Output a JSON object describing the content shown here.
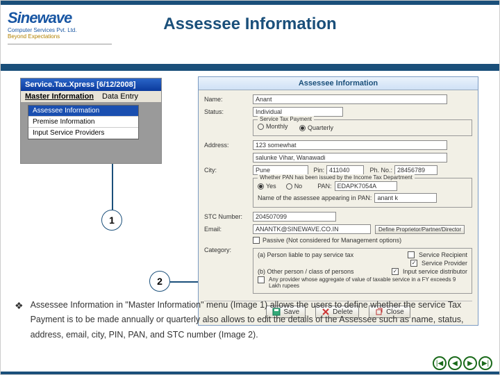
{
  "logo": {
    "name": "Sinewave",
    "sub1": "Computer Services Pvt. Ltd.",
    "sub2": "Beyond Expectations"
  },
  "page_title": "Assessee Information",
  "menu": {
    "window_title": "Service.Tax.Xpress  [6/12/2008]",
    "bar": [
      "Master Information",
      "Data Entry"
    ],
    "items": [
      "Assessee Information",
      "Premise Information",
      "Input Service Providers"
    ]
  },
  "callouts": {
    "one": "1",
    "two": "2"
  },
  "dialog": {
    "title": "Assessee Information",
    "labels": {
      "name": "Name:",
      "status": "Status:",
      "address": "Address:",
      "city": "City:",
      "pin": "Pin:",
      "phno": "Ph. No.:",
      "stc": "STC Number:",
      "email": "Email:",
      "category": "Category:",
      "pan": "PAN:",
      "panname": "Name of the assessee appearing in PAN:",
      "legend_tax": "Service Tax Payment",
      "legend_pan": "Whether PAN has been issued by the Income Tax Department",
      "monthly": "Monthly",
      "quarterly": "Quarterly",
      "yes": "Yes",
      "no": "No",
      "define": "Define Proprietor/Partner/Director",
      "passive": "Passive (Not considered for Management options)"
    },
    "values": {
      "name": "Anant",
      "status": "Individual",
      "address": "123 somewhat",
      "addr2": "salunke Vihar, Wanawadi",
      "city": "Pune",
      "pin": "411040",
      "phno": "28456789",
      "pan": "EDAPK7054A",
      "panname": "anant k",
      "stc": "204507099",
      "email": "ANANTK@SINEWAVE.CO.IN"
    },
    "category": {
      "a_label": "(a) Person liable to pay service tax",
      "a_sr": "Service Recipient",
      "a_sp": "Service Provider",
      "b_label": "(b) Other person / class of persons",
      "b_isd": "Input service distributor",
      "c_label": "Any provider whose aggregate of value of taxable service in a FY exceeds 9 Lakh rupees"
    },
    "buttons": {
      "save": "Save",
      "delete": "Delete",
      "close": "Close"
    }
  },
  "bullet": {
    "marker": "❖",
    "text": "Assessee Information in \"Master Information\" menu (Image 1) allows the users  to define whether the service Tax Payment is to be made annually or quarterly also allows to edit the details of the Assessee such as name, status, address, email, city, PIN, PAN, and STC number (Image 2)."
  },
  "nav": {
    "first": "|◀",
    "prev": "◀",
    "next": "▶",
    "last": "▶|"
  }
}
